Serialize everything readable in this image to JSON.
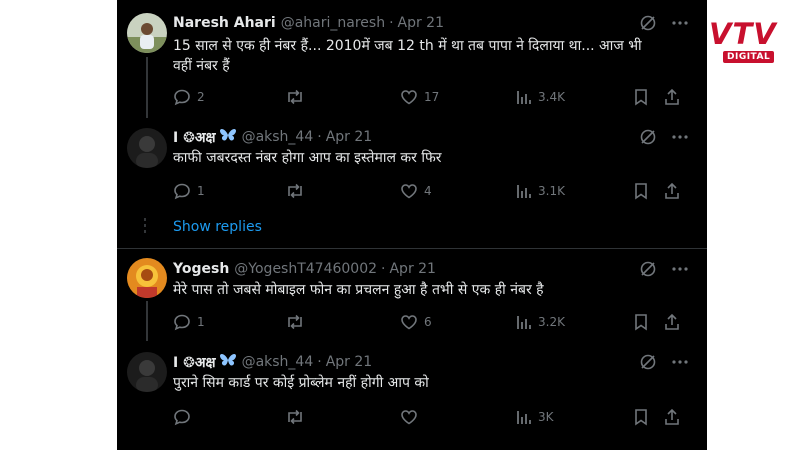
{
  "brand": {
    "logo_main": "VTV",
    "logo_sub": "DIGITAL"
  },
  "thread": {
    "tweets": [
      {
        "name": "Naresh Ahari",
        "handle": "@ahari_naresh",
        "sep": "·",
        "date": "Apr 21",
        "text": "15 साल से एक ही नंबर हैं... 2010में जब 12 th में था तब पापा ने दिलाया था... आज भी वहीं नंबर हैं",
        "replies": "2",
        "retweets": "",
        "likes": "17",
        "views": "3.4K",
        "avatar": "avatar-photo-outdoor"
      },
      {
        "name": "I ❂अक्ष",
        "badge": "butterfly-icon",
        "handle": "@aksh_44",
        "sep": "·",
        "date": "Apr 21",
        "text": "काफी जबरदस्त नंबर होगा आप का इस्तेमाल कर फिर",
        "replies": "1",
        "retweets": "",
        "likes": "4",
        "views": "3.1K",
        "avatar": "avatar-dark"
      },
      {
        "name": "Yogesh",
        "handle": "@YogeshT47460002",
        "sep": "·",
        "date": "Apr 21",
        "text": "मेरे पास तो जबसे मोबाइल फोन का प्रचलन हुआ है तभी से एक ही नंबर है",
        "replies": "1",
        "retweets": "",
        "likes": "6",
        "views": "3.2K",
        "avatar": "avatar-deity-orange"
      },
      {
        "name": "I ❂अक्ष",
        "badge": "butterfly-icon",
        "handle": "@aksh_44",
        "sep": "·",
        "date": "Apr 21",
        "text": "पुराने सिम कार्ड पर कोई प्रोब्लेम नहीं होगी आप को",
        "replies": "",
        "retweets": "",
        "likes": "",
        "views": "3K",
        "avatar": "avatar-dark"
      }
    ],
    "show_replies": "Show replies"
  },
  "colors": {
    "background": "#000000",
    "text_primary": "#e7e9ea",
    "text_secondary": "#71767b",
    "link": "#1d9bf0",
    "divider": "#2f3336",
    "brand_red": "#c8102e"
  }
}
